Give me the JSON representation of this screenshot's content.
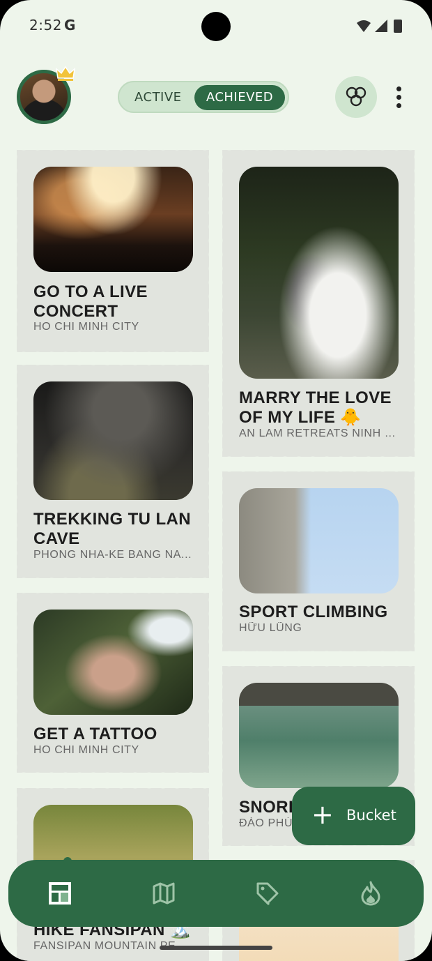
{
  "status_bar": {
    "time": "2:52",
    "g_icon": "G"
  },
  "header": {
    "toggle": {
      "active_label": "ACTIVE",
      "achieved_label": "ACHIEVED",
      "selected": "ACHIEVED"
    }
  },
  "cards": [
    {
      "title": "GO TO A LIVE CONCERT",
      "subtitle": "HO CHI MINH CITY"
    },
    {
      "title": "TREKKING TU LAN CAVE",
      "subtitle": "PHONG NHA-KE BANG NA..."
    },
    {
      "title": "GET A TATTOO",
      "subtitle": "HO CHI MINH CITY"
    },
    {
      "title": "HIKE FANSIPAN 🏔️",
      "subtitle": "FANSIPAN MOUNTAIN PEA..."
    },
    {
      "title": "MARRY THE LOVE OF MY LIFE 🐥",
      "subtitle": "AN LAM RETREATS NINH V..."
    },
    {
      "title": "SPORT CLIMBING",
      "subtitle": "HỮU LŨNG"
    },
    {
      "title": "SNORK",
      "subtitle": "ĐÀO PHÚ"
    }
  ],
  "fab": {
    "icon": "plus-icon",
    "label": "Bucket"
  },
  "bottom_nav": {
    "items": [
      {
        "icon": "dashboard-icon",
        "selected": true
      },
      {
        "icon": "map-icon",
        "selected": false
      },
      {
        "icon": "tag-icon",
        "selected": false
      },
      {
        "icon": "flame-icon",
        "selected": false
      }
    ]
  },
  "colors": {
    "primary": "#2d6a45",
    "background": "#eef5eb",
    "card": "#e1e4de",
    "toggle_bg": "#cfe5cf"
  }
}
